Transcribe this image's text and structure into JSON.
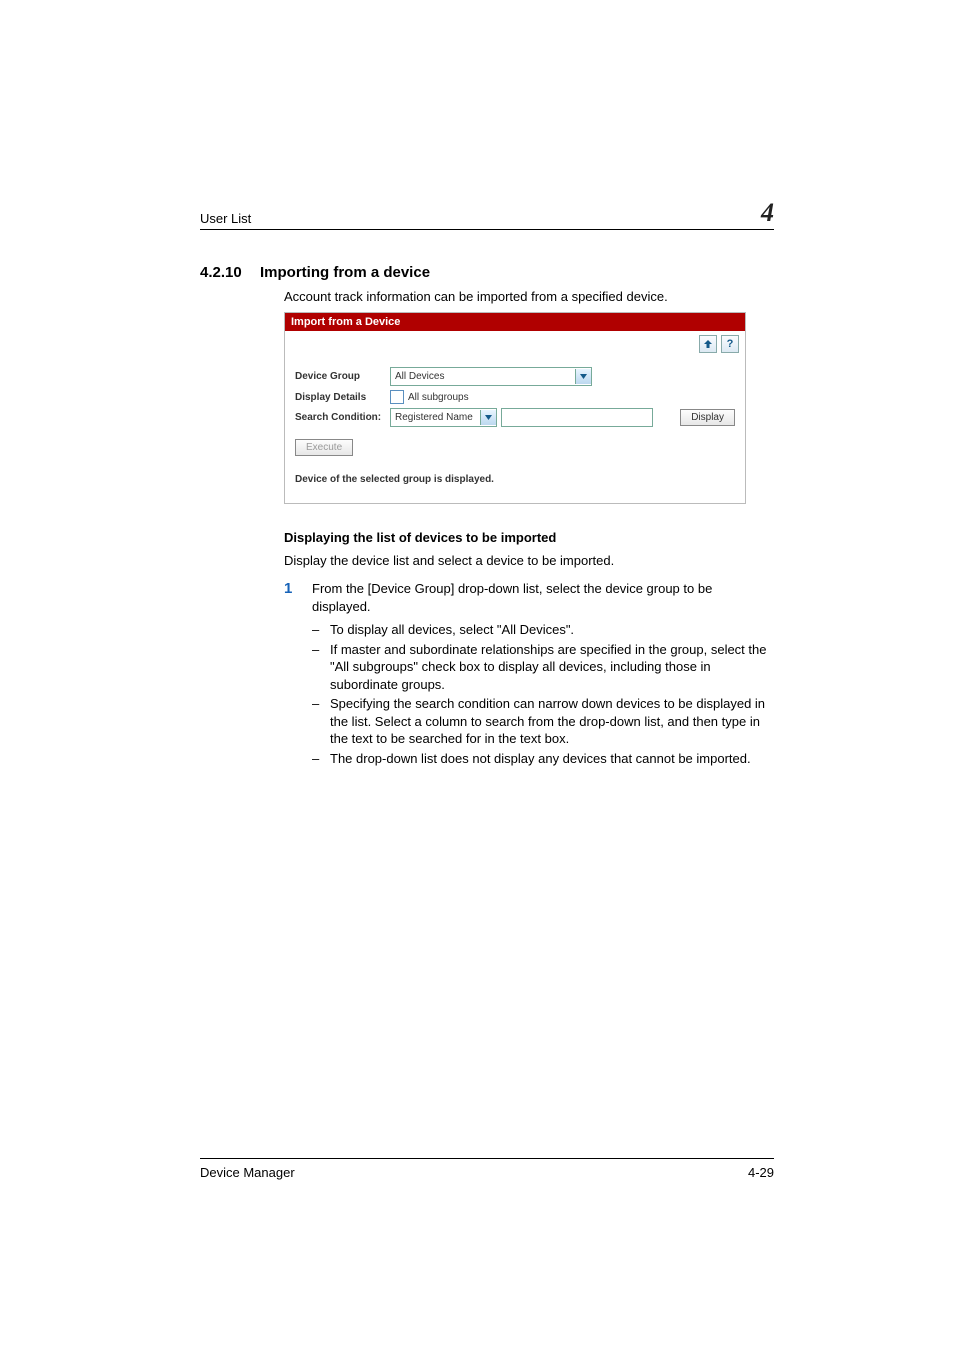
{
  "header": {
    "running": "User List",
    "chapter": "4"
  },
  "section": {
    "number": "4.2.10",
    "title": "Importing from a device",
    "intro": "Account track information can be imported from a specified device."
  },
  "screenshot": {
    "title": "Import from a Device",
    "toolbar": {
      "back_icon": "↥",
      "help_icon": "?"
    },
    "fields": {
      "device_group_label": "Device Group",
      "device_group_value": "All Devices",
      "display_details_label": "Display Details",
      "all_subgroups_label": "All subgroups",
      "search_condition_label": "Search Condition:",
      "search_condition_value": "Registered Name",
      "display_btn": "Display",
      "execute_btn": "Execute"
    },
    "status": "Device of the selected group is displayed."
  },
  "subsection": {
    "heading": "Displaying the list of devices to be imported",
    "lead": "Display the device list and select a device to be imported."
  },
  "step1": {
    "num": "1",
    "text": "From the [Device Group] drop-down list, select the device group to be displayed.",
    "bullets": [
      "To display all devices, select \"All Devices\".",
      "If master and subordinate relationships are specified in the group, select the \"All subgroups\" check box to display all devices, including those in subordinate groups.",
      "Specifying the search condition can narrow down devices to be displayed in the list. Select a column to search from the drop-down list, and then type in the text to be searched for in the text box.",
      "The drop-down list does not display any devices that cannot be imported."
    ]
  },
  "footer": {
    "product": "Device Manager",
    "page": "4-29"
  }
}
